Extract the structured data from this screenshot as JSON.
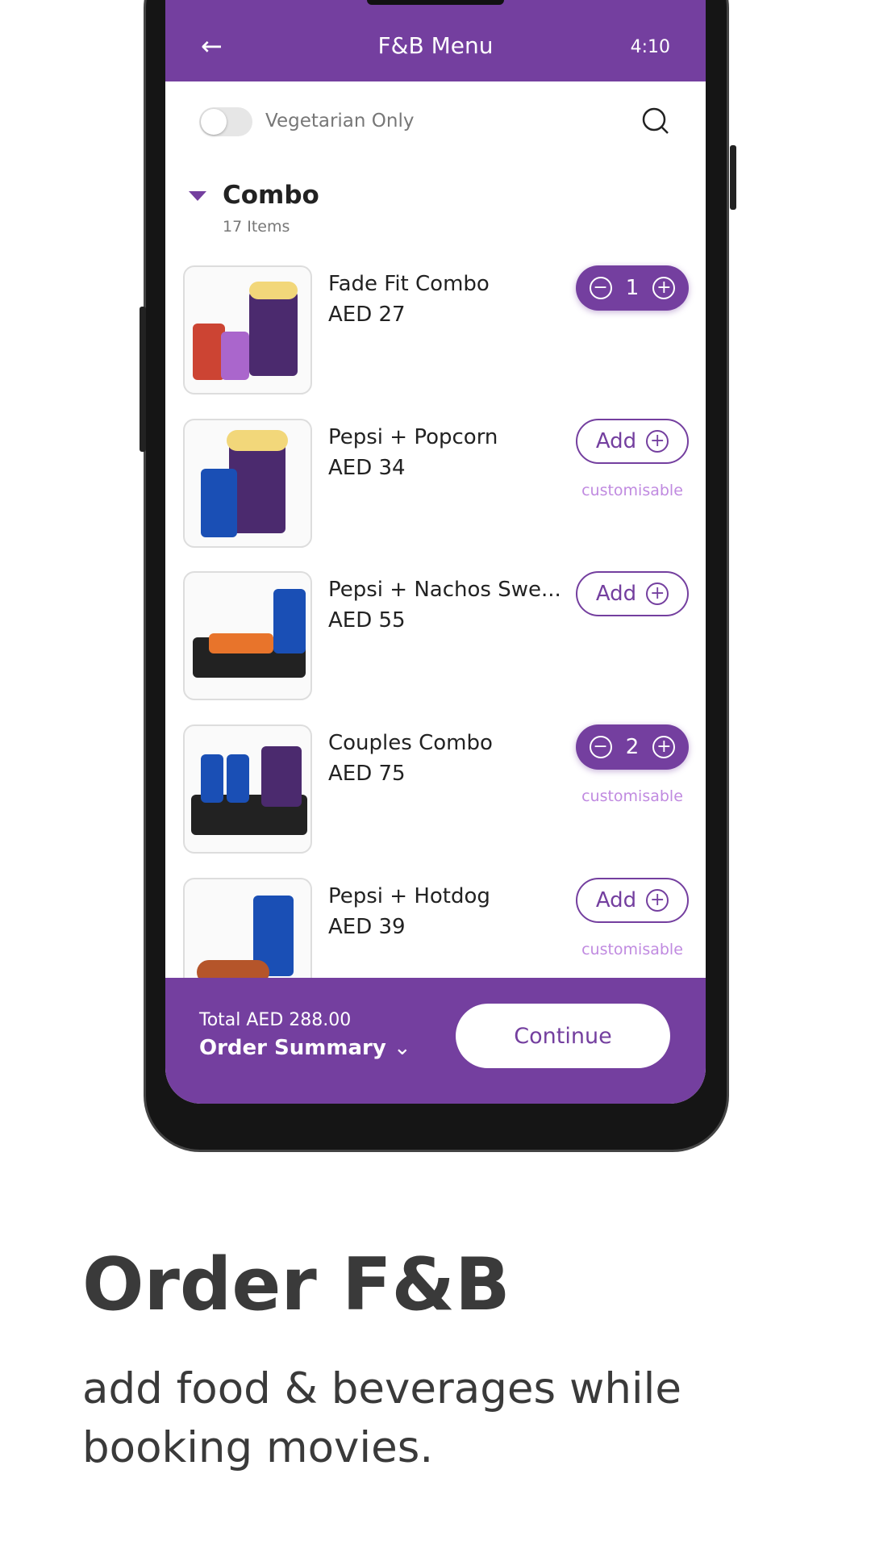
{
  "header": {
    "back_icon": "arrow-left-icon",
    "title": "F&B Menu",
    "time": "4:10"
  },
  "filter": {
    "veg_label": "Vegetarian Only",
    "veg_on": false,
    "search_icon": "search-icon"
  },
  "category": {
    "name": "Combo",
    "count": "17 Items"
  },
  "items": [
    {
      "name": "Fade Fit Combo",
      "price": "AED 27",
      "quantity": "1",
      "customisable": ""
    },
    {
      "name": "Pepsi + Popcorn",
      "price": "AED 34",
      "add": "Add",
      "customisable": "customisable"
    },
    {
      "name": "Pepsi + Nachos Swe...",
      "price": "AED 55",
      "add": "Add",
      "customisable": ""
    },
    {
      "name": "Couples Combo",
      "price": "AED 75",
      "quantity": "2",
      "customisable": "customisable"
    },
    {
      "name": "Pepsi + Hotdog",
      "price": "AED 39",
      "add": "Add",
      "customisable": "customisable"
    }
  ],
  "footer": {
    "total": "Total AED 288.00",
    "summary": "Order Summary",
    "continue": "Continue"
  },
  "promo": {
    "title": "Order F&B",
    "subtitle": "add food & beverages while booking movies."
  },
  "colors": {
    "brand": "#743f9f",
    "customisable": "#c08ae0"
  }
}
